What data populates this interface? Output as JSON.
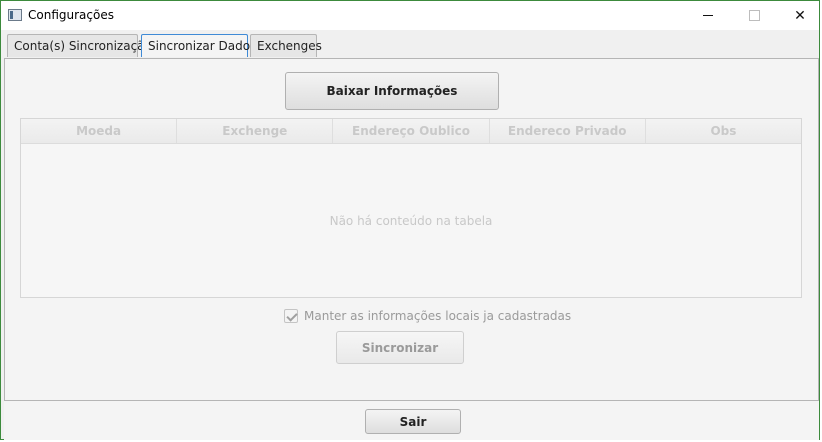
{
  "window": {
    "title": "Configurações",
    "controls": {
      "minimize": "—",
      "maximize": "□",
      "close": "✕"
    }
  },
  "tabs": [
    {
      "label": "Conta(s) Sincronização",
      "selected": false
    },
    {
      "label": "Sincronizar Dados",
      "selected": true
    },
    {
      "label": "Exchenges",
      "selected": false
    }
  ],
  "main": {
    "download_button": "Baixar Informações",
    "table": {
      "columns": [
        "Moeda",
        "Exchenge",
        "Endereço Oublico",
        "Endereco Privado",
        "Obs"
      ],
      "empty_message": "Não há conteúdo na tabela"
    },
    "keep_local_checkbox": {
      "label": "Manter as informações locais ja cadastradas",
      "checked": true
    },
    "sync_button": "Sincronizar"
  },
  "footer": {
    "exit_button": "Sair"
  },
  "colors": {
    "window_border": "#3c8a3c",
    "selected_tab_border": "#3f8ad6",
    "disabled_text": "#9a9a9a"
  }
}
